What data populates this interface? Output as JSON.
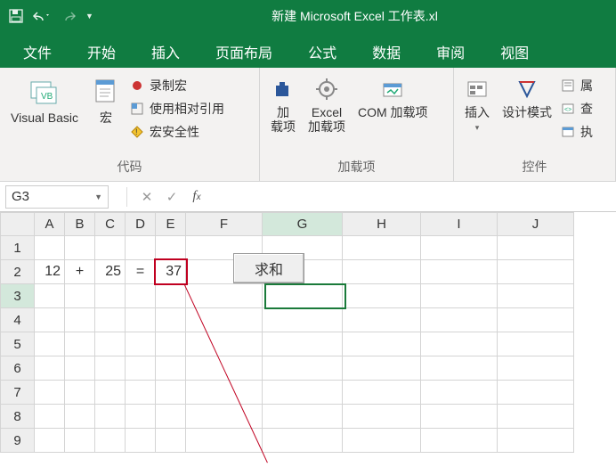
{
  "title": "新建 Microsoft Excel 工作表.xl",
  "tabs": [
    "文件",
    "开始",
    "插入",
    "页面布局",
    "公式",
    "数据",
    "审阅",
    "视图"
  ],
  "ribbon": {
    "group_code": {
      "label": "代码",
      "vb": "Visual Basic",
      "macros": "宏",
      "record": "录制宏",
      "relative": "使用相对引用",
      "security": "宏安全性"
    },
    "group_addins": {
      "label": "加载项",
      "addins": "加\n载项",
      "excel_addins": "Excel\n加载项",
      "com": "COM 加载项"
    },
    "group_controls": {
      "label": "控件",
      "insert": "插入",
      "design": "设计模式",
      "props": "属",
      "viewcode": "查",
      "rundlg": "执"
    }
  },
  "namebox": "G3",
  "formula": "",
  "columns": [
    "A",
    "B",
    "C",
    "D",
    "E",
    "F",
    "G",
    "H",
    "I",
    "J"
  ],
  "rows": [
    "1",
    "2",
    "3",
    "4",
    "5",
    "6",
    "7",
    "8",
    "9"
  ],
  "selected_col": "G",
  "selected_row": "3",
  "cells": {
    "A2": "12",
    "B2": "+",
    "C2": "25",
    "D2": "=",
    "E2": "37"
  },
  "button_label": "求和"
}
